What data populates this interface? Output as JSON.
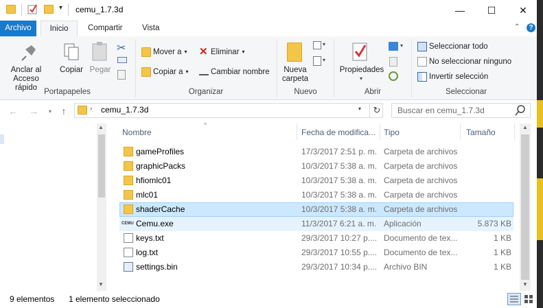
{
  "window": {
    "title": "cemu_1.7.3d",
    "minimize_glyph": "—",
    "maximize_glyph": "☐",
    "close_glyph": "✕"
  },
  "tabs": [
    {
      "label": "Archivo"
    },
    {
      "label": "Inicio"
    },
    {
      "label": "Compartir"
    },
    {
      "label": "Vista"
    }
  ],
  "ribbon": {
    "groups": {
      "portapapeles": "Portapapeles",
      "organizar": "Organizar",
      "nuevo": "Nuevo",
      "abrir": "Abrir",
      "seleccionar": "Seleccionar"
    },
    "anclar": "Anclar al\nAcceso rápido",
    "copiar": "Copiar",
    "pegar": "Pegar",
    "mover_a": "Mover a",
    "copiar_a": "Copiar a",
    "eliminar": "Eliminar",
    "cambiar_nombre": "Cambiar nombre",
    "nueva_carpeta": "Nueva\ncarpeta",
    "propiedades": "Propiedades",
    "seleccionar_todo": "Seleccionar todo",
    "no_seleccionar_ninguno": "No seleccionar ninguno",
    "invertir_seleccion": "Invertir selección"
  },
  "address": {
    "path": "cemu_1.7.3d",
    "search_placeholder": "Buscar en cemu_1.7.3d"
  },
  "columns": {
    "nombre": "Nombre",
    "fecha": "Fecha de modifica...",
    "tipo": "Tipo",
    "tamano": "Tamaño"
  },
  "files": [
    {
      "name": "gameProfiles",
      "date": "17/3/2017 2:51 p. m.",
      "type": "Carpeta de archivos",
      "size": "",
      "icon": "folder-icon"
    },
    {
      "name": "graphicPacks",
      "date": "10/3/2017 5:38 a. m.",
      "type": "Carpeta de archivos",
      "size": "",
      "icon": "folder-icon"
    },
    {
      "name": "hfiomlc01",
      "date": "10/3/2017 5:38 a. m.",
      "type": "Carpeta de archivos",
      "size": "",
      "icon": "folder-icon"
    },
    {
      "name": "mlc01",
      "date": "10/3/2017 5:38 a. m.",
      "type": "Carpeta de archivos",
      "size": "",
      "icon": "folder-icon"
    },
    {
      "name": "shaderCache",
      "date": "10/3/2017 5:38 a. m.",
      "type": "Carpeta de archivos",
      "size": "",
      "icon": "folder-icon"
    },
    {
      "name": "Cemu.exe",
      "date": "11/3/2017 6:21 a. m.",
      "type": "Aplicación",
      "size": "5.873 KB",
      "icon": "cemu-app-icon"
    },
    {
      "name": "keys.txt",
      "date": "29/3/2017 10:27 p....",
      "type": "Documento de tex...",
      "size": "1 KB",
      "icon": "text-file-icon"
    },
    {
      "name": "log.txt",
      "date": "29/3/2017 10:55 p....",
      "type": "Documento de tex...",
      "size": "1 KB",
      "icon": "text-file-icon"
    },
    {
      "name": "settings.bin",
      "date": "29/3/2017 10:34 p....",
      "type": "Archivo BIN",
      "size": "1 KB",
      "icon": "bin-file-icon"
    }
  ],
  "cemu_icon_text": "CEMU",
  "status": {
    "count": "9 elementos",
    "selected": "1 elemento seleccionado"
  }
}
